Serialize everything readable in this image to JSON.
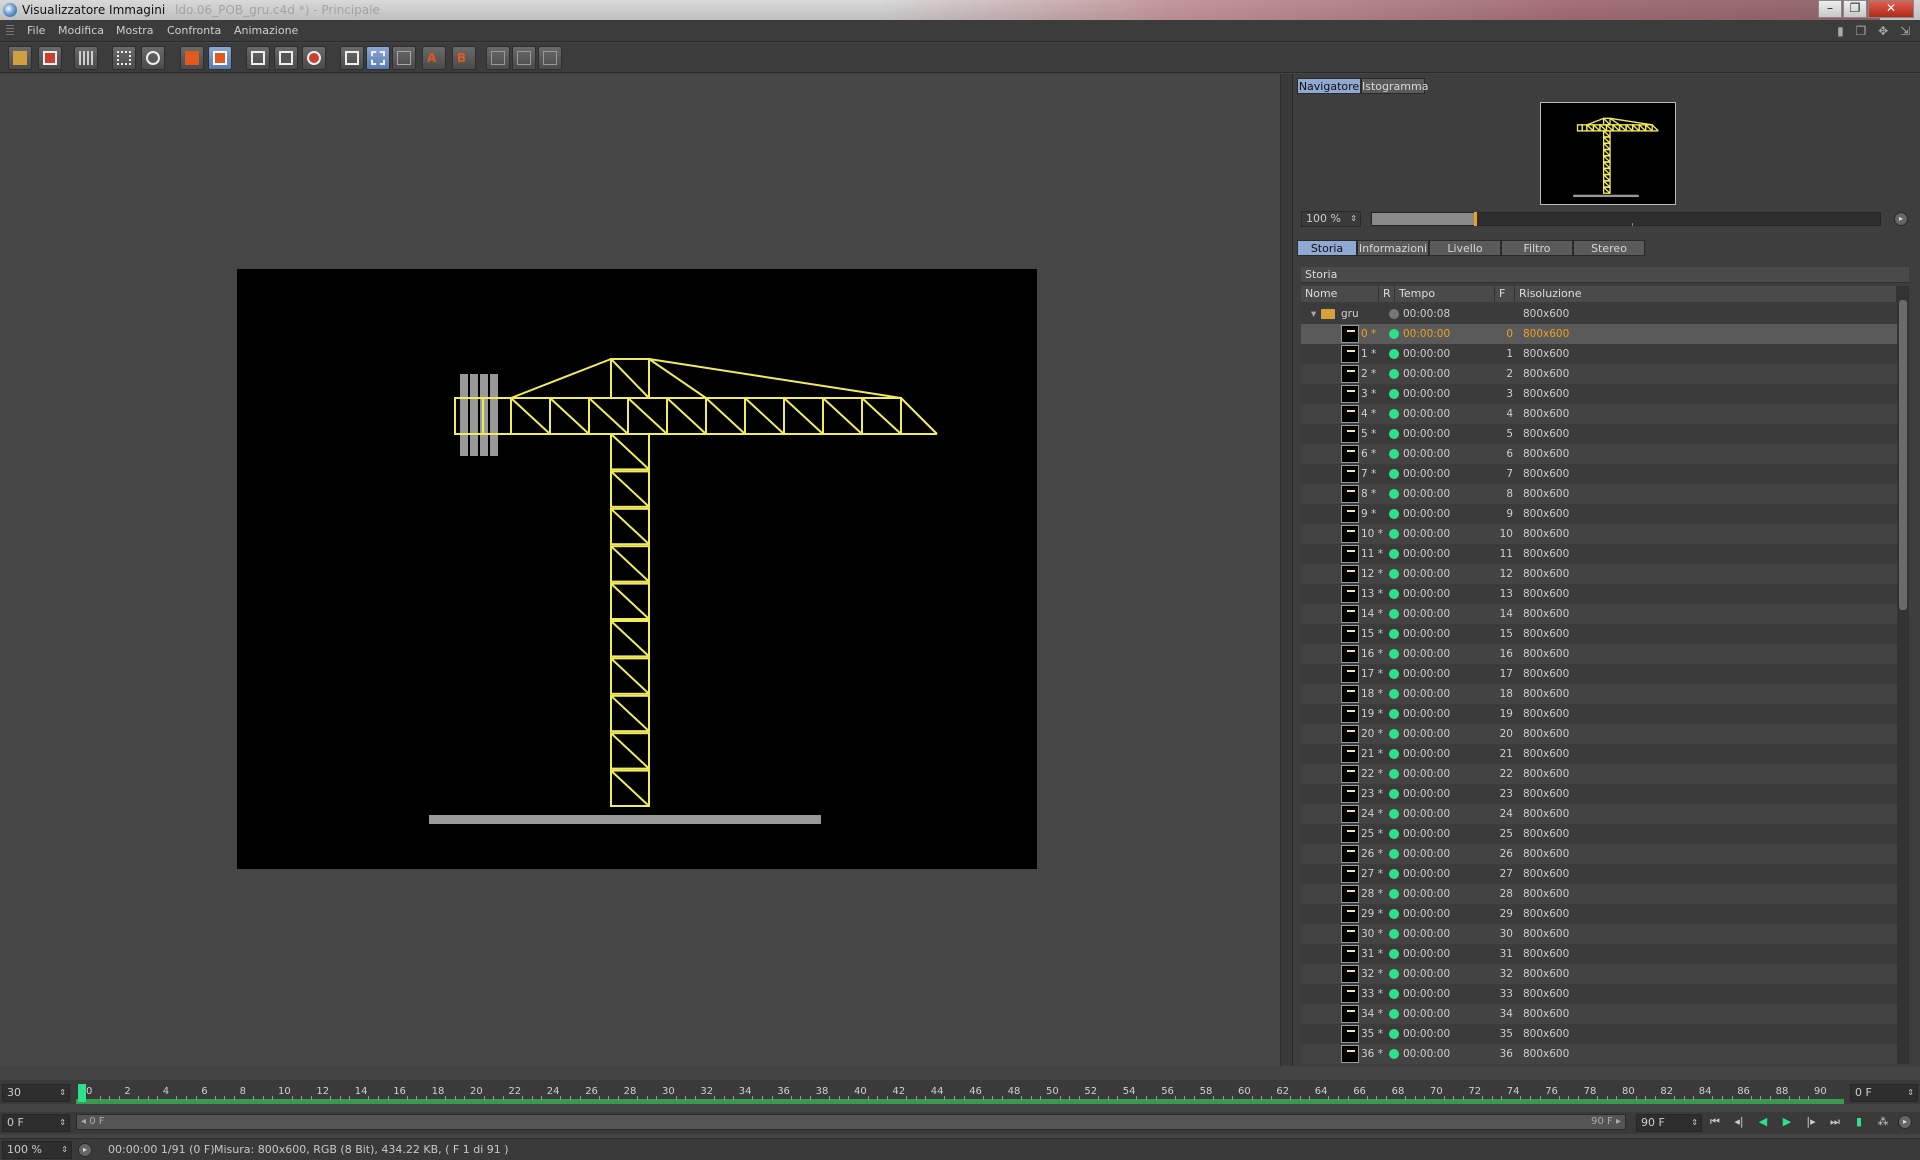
{
  "window": {
    "title": "Visualizzatore Immagini",
    "ghost_title": "ldo.06_POB_gru.c4d *) - Principale"
  },
  "menu": [
    "File",
    "Modifica",
    "Mostra",
    "Confronta",
    "Animazione"
  ],
  "navigator": {
    "tabs": [
      "Navigatore",
      "Istogramma"
    ],
    "zoom": "100 %",
    "zoom_fraction": 0.2
  },
  "panel_tabs": [
    "Storia",
    "Informazioni",
    "Livello",
    "Filtro",
    "Stereo"
  ],
  "history": {
    "header": "Storia",
    "columns": [
      "Nome",
      "R",
      "Tempo Rendering",
      "F",
      "Risoluzione"
    ],
    "group": {
      "name": "gru",
      "time": "00:00:08",
      "resolution": "800x600"
    },
    "rows": [
      {
        "name": "0 *",
        "time": "00:00:00",
        "frame": "0",
        "res": "800x600"
      },
      {
        "name": "1 *",
        "time": "00:00:00",
        "frame": "1",
        "res": "800x600"
      },
      {
        "name": "2 *",
        "time": "00:00:00",
        "frame": "2",
        "res": "800x600"
      },
      {
        "name": "3 *",
        "time": "00:00:00",
        "frame": "3",
        "res": "800x600"
      },
      {
        "name": "4 *",
        "time": "00:00:00",
        "frame": "4",
        "res": "800x600"
      },
      {
        "name": "5 *",
        "time": "00:00:00",
        "frame": "5",
        "res": "800x600"
      },
      {
        "name": "6 *",
        "time": "00:00:00",
        "frame": "6",
        "res": "800x600"
      },
      {
        "name": "7 *",
        "time": "00:00:00",
        "frame": "7",
        "res": "800x600"
      },
      {
        "name": "8 *",
        "time": "00:00:00",
        "frame": "8",
        "res": "800x600"
      },
      {
        "name": "9 *",
        "time": "00:00:00",
        "frame": "9",
        "res": "800x600"
      },
      {
        "name": "10 *",
        "time": "00:00:00",
        "frame": "10",
        "res": "800x600"
      },
      {
        "name": "11 *",
        "time": "00:00:00",
        "frame": "11",
        "res": "800x600"
      },
      {
        "name": "12 *",
        "time": "00:00:00",
        "frame": "12",
        "res": "800x600"
      },
      {
        "name": "13 *",
        "time": "00:00:00",
        "frame": "13",
        "res": "800x600"
      },
      {
        "name": "14 *",
        "time": "00:00:00",
        "frame": "14",
        "res": "800x600"
      },
      {
        "name": "15 *",
        "time": "00:00:00",
        "frame": "15",
        "res": "800x600"
      },
      {
        "name": "16 *",
        "time": "00:00:00",
        "frame": "16",
        "res": "800x600"
      },
      {
        "name": "17 *",
        "time": "00:00:00",
        "frame": "17",
        "res": "800x600"
      },
      {
        "name": "18 *",
        "time": "00:00:00",
        "frame": "18",
        "res": "800x600"
      },
      {
        "name": "19 *",
        "time": "00:00:00",
        "frame": "19",
        "res": "800x600"
      },
      {
        "name": "20 *",
        "time": "00:00:00",
        "frame": "20",
        "res": "800x600"
      },
      {
        "name": "21 *",
        "time": "00:00:00",
        "frame": "21",
        "res": "800x600"
      },
      {
        "name": "22 *",
        "time": "00:00:00",
        "frame": "22",
        "res": "800x600"
      },
      {
        "name": "23 *",
        "time": "00:00:00",
        "frame": "23",
        "res": "800x600"
      },
      {
        "name": "24 *",
        "time": "00:00:00",
        "frame": "24",
        "res": "800x600"
      },
      {
        "name": "25 *",
        "time": "00:00:00",
        "frame": "25",
        "res": "800x600"
      },
      {
        "name": "26 *",
        "time": "00:00:00",
        "frame": "26",
        "res": "800x600"
      },
      {
        "name": "27 *",
        "time": "00:00:00",
        "frame": "27",
        "res": "800x600"
      },
      {
        "name": "28 *",
        "time": "00:00:00",
        "frame": "28",
        "res": "800x600"
      },
      {
        "name": "29 *",
        "time": "00:00:00",
        "frame": "29",
        "res": "800x600"
      },
      {
        "name": "30 *",
        "time": "00:00:00",
        "frame": "30",
        "res": "800x600"
      },
      {
        "name": "31 *",
        "time": "00:00:00",
        "frame": "31",
        "res": "800x600"
      },
      {
        "name": "32 *",
        "time": "00:00:00",
        "frame": "32",
        "res": "800x600"
      },
      {
        "name": "33 *",
        "time": "00:00:00",
        "frame": "33",
        "res": "800x600"
      },
      {
        "name": "34 *",
        "time": "00:00:00",
        "frame": "34",
        "res": "800x600"
      },
      {
        "name": "35 *",
        "time": "00:00:00",
        "frame": "35",
        "res": "800x600"
      },
      {
        "name": "36 *",
        "time": "00:00:00",
        "frame": "36",
        "res": "800x600"
      }
    ],
    "selected_row": 0
  },
  "timeline": {
    "fps": "30",
    "ticks": [
      "0",
      "2",
      "4",
      "6",
      "8",
      "10",
      "12",
      "14",
      "16",
      "18",
      "20",
      "22",
      "24",
      "26",
      "28",
      "30",
      "32",
      "34",
      "36",
      "38",
      "40",
      "42",
      "44",
      "46",
      "48",
      "50",
      "52",
      "54",
      "56",
      "58",
      "60",
      "62",
      "64",
      "66",
      "68",
      "70",
      "72",
      "74",
      "76",
      "78",
      "80",
      "82",
      "84",
      "86",
      "88",
      "90"
    ],
    "current_frame": "0 F",
    "start_field": "0 F",
    "range_start": "0 F",
    "range_end": "90 F",
    "end_field": "90 F"
  },
  "status": {
    "zoom": "100 %",
    "time": "00:00:00 1/91 (0 F)",
    "info": "Misura: 800x600, RGB (8 Bit), 434.22 KB,  ( F 1 di 91 )"
  },
  "colors": {
    "crane": "#f2ec5a",
    "accent": "#f0a020",
    "selected_tab": "#8fa9d2",
    "status_green": "#2ee08a"
  },
  "icons": {
    "toolbar": [
      "open-icon",
      "save-icon",
      "grid-icon",
      "fit-icon",
      "zoom-icon",
      "copy-icon",
      "paste-icon",
      "render-icon",
      "render-region-icon",
      "render-all-icon",
      "ab-compare-icon",
      "ab-split-icon",
      "ab-wipe-icon",
      "set-a-icon",
      "set-b-icon",
      "layout-1-icon",
      "layout-2-icon",
      "layout-3-icon"
    ],
    "playback": [
      "first-frame-icon",
      "prev-key-icon",
      "play-backward-icon",
      "play-forward-icon",
      "next-key-icon",
      "last-frame-icon"
    ]
  }
}
